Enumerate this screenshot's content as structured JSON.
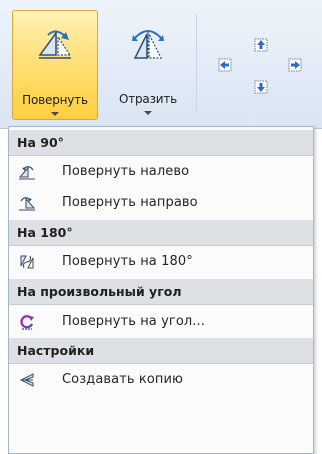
{
  "ribbon": {
    "rotate_label": "Повернуть",
    "flip_label": "Отразить"
  },
  "menu": {
    "sections": [
      {
        "header": "На 90°",
        "items": [
          {
            "label": "Повернуть налево",
            "icon": "rotate-left-icon"
          },
          {
            "label": "Повернуть направо",
            "icon": "rotate-right-icon"
          }
        ]
      },
      {
        "header": "На 180°",
        "items": [
          {
            "label": "Повернуть на 180°",
            "icon": "rotate-180-icon"
          }
        ]
      },
      {
        "header": "На произвольный угол",
        "items": [
          {
            "label": "Повернуть на угол...",
            "icon": "rotate-angle-icon"
          }
        ]
      },
      {
        "header": "Настройки",
        "items": [
          {
            "label": "Создавать копию",
            "icon": "create-copy-icon"
          }
        ]
      }
    ]
  },
  "colors": {
    "active_button": "#ffd55a",
    "ribbon_bg": "#e2ebf6",
    "header_bg": "#dde1e6"
  }
}
